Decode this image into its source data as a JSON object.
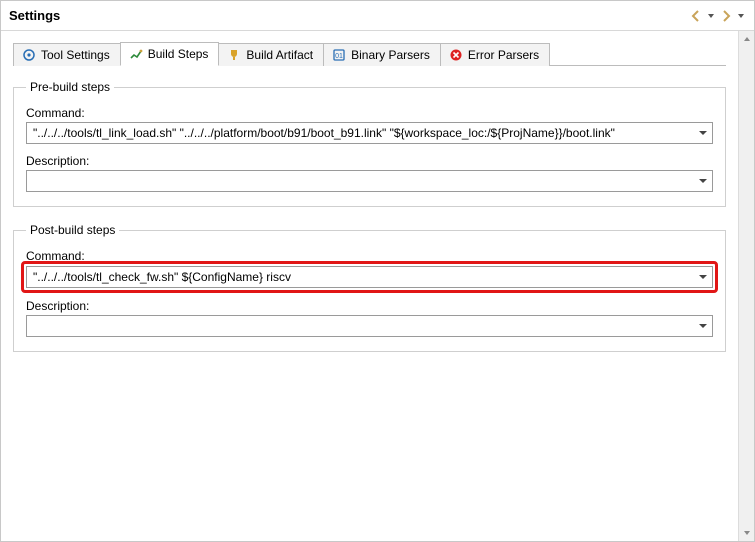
{
  "title": "Settings",
  "tabs": [
    {
      "label": "Tool Settings"
    },
    {
      "label": "Build Steps"
    },
    {
      "label": "Build Artifact"
    },
    {
      "label": "Binary Parsers"
    },
    {
      "label": "Error Parsers"
    }
  ],
  "preBuild": {
    "legend": "Pre-build steps",
    "commandLabel": "Command:",
    "commandValue": "\"../../../tools/tl_link_load.sh\" \"../../../platform/boot/b91/boot_b91.link\" \"${workspace_loc:/${ProjName}}/boot.link\"",
    "descriptionLabel": "Description:",
    "descriptionValue": ""
  },
  "postBuild": {
    "legend": "Post-build steps",
    "commandLabel": "Command:",
    "commandValue": "\"../../../tools/tl_check_fw.sh\" ${ConfigName} riscv",
    "descriptionLabel": "Description:",
    "descriptionValue": ""
  }
}
